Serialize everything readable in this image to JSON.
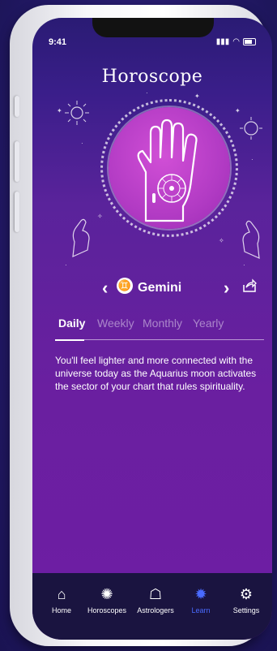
{
  "status": {
    "time": "9:41"
  },
  "header": {
    "title": "Horoscope"
  },
  "sign": {
    "name": "Gemini",
    "symbol": "♊"
  },
  "tabs": [
    {
      "label": "Daily",
      "active": true
    },
    {
      "label": "Weekly",
      "active": false
    },
    {
      "label": "Monthly",
      "active": false
    },
    {
      "label": "Yearly",
      "active": false
    }
  ],
  "content": {
    "description": "You'll feel lighter and more connected with the universe today as the Aquarius moon activates the sector of your chart that rules spirituality."
  },
  "nav": [
    {
      "label": "Home",
      "icon": "home-icon",
      "active": false
    },
    {
      "label": "Horoscopes",
      "icon": "zodiac-wheel-icon",
      "active": false
    },
    {
      "label": "Astrologers",
      "icon": "astrologer-icon",
      "active": false
    },
    {
      "label": "Learn",
      "icon": "bulb-icon",
      "active": true
    },
    {
      "label": "Settings",
      "icon": "settings-gear-icon",
      "active": false
    }
  ],
  "colors": {
    "accent": "#4a6bff",
    "background": "#6a1fa0",
    "circle": "#b23bc4"
  }
}
